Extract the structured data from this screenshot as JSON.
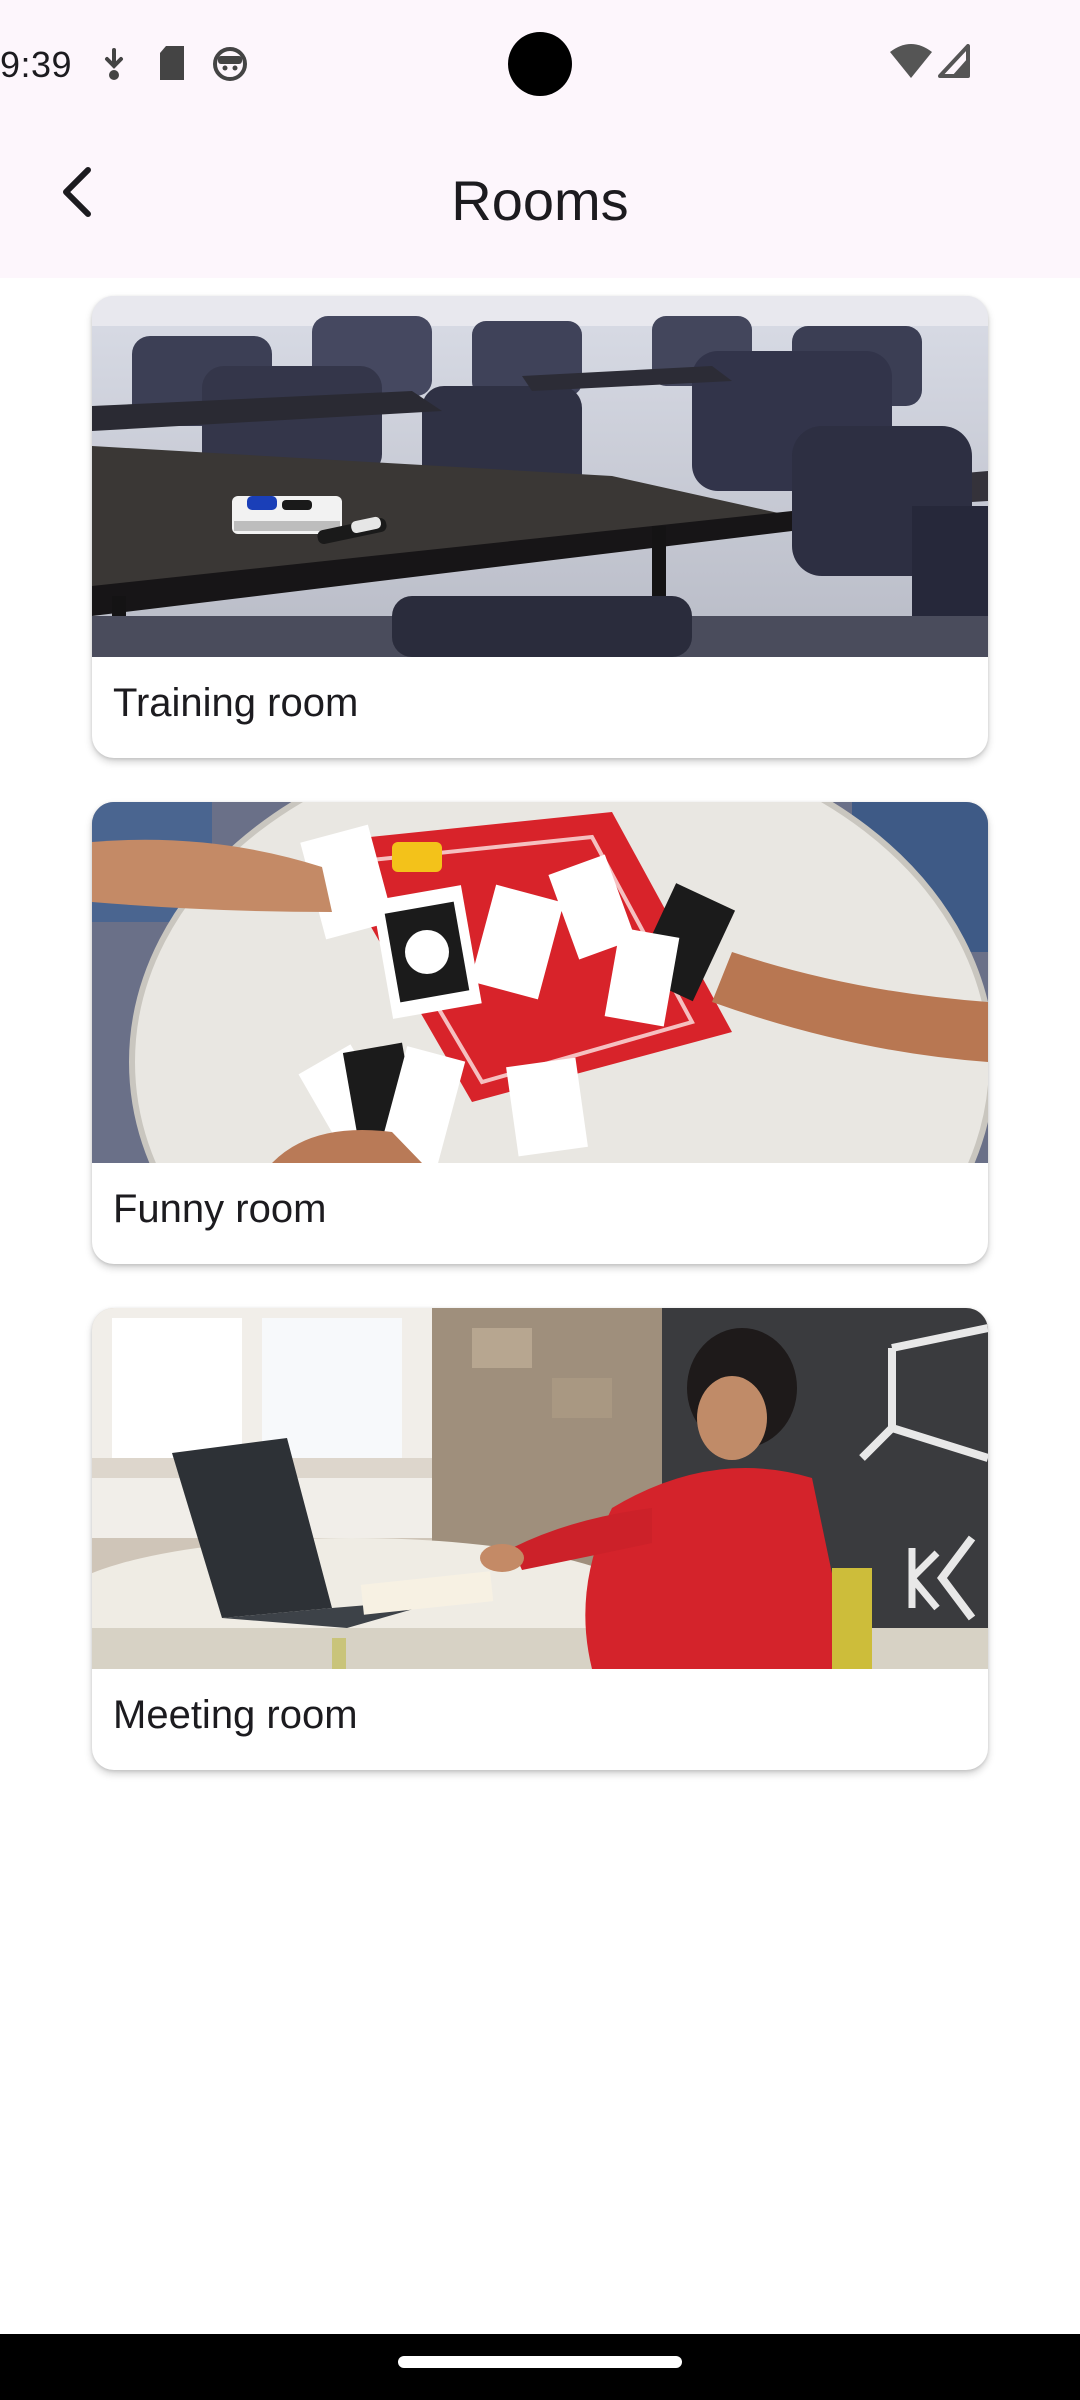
{
  "status_bar": {
    "time": "9:39",
    "icons": [
      "download-arrow-icon",
      "sd-card-icon",
      "face-icon",
      "wifi-icon",
      "cellular-signal-icon"
    ]
  },
  "app_bar": {
    "back_icon": "chevron-left-icon",
    "title": "Rooms"
  },
  "rooms": [
    {
      "label": "Training room",
      "image": "classroom-desks-photo"
    },
    {
      "label": "Funny room",
      "image": "card-game-table-photo"
    },
    {
      "label": "Meeting room",
      "image": "person-with-laptop-photo"
    }
  ],
  "colors": {
    "app_bar_background": "#fdf6fc",
    "text": "#1c1b1f",
    "card_background": "#ffffff",
    "nav_bar": "#000000"
  }
}
